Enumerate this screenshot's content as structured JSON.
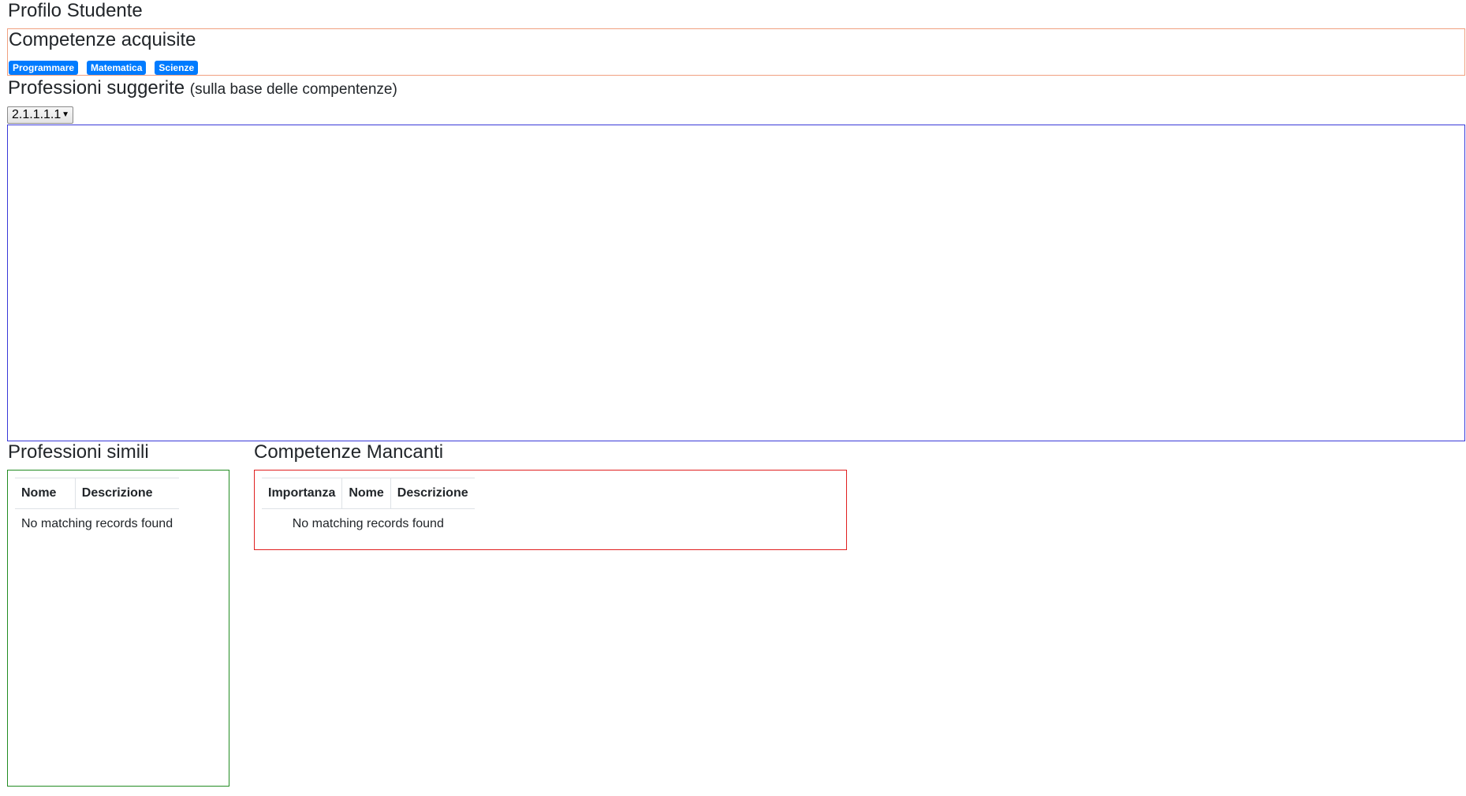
{
  "page": {
    "title": "Profilo Studente"
  },
  "acquired_skills": {
    "title": "Competenze acquisite",
    "badges": [
      "Programmare",
      "Matematica",
      "Scienze"
    ],
    "badge_color": "#007bff",
    "border_color": "#f0a080"
  },
  "suggested_professions": {
    "title": "Professioni suggerite",
    "subtitle": "(sulla base delle compentenze)",
    "select_value": "2.1.1.1.1",
    "border_color": "#3838d8"
  },
  "similar_professions": {
    "title": "Professioni simili",
    "columns": [
      "Nome",
      "Descrizione"
    ],
    "empty_message": "No matching records found",
    "border_color": "#228b22"
  },
  "missing_skills": {
    "title": "Competenze Mancanti",
    "columns": [
      "Importanza",
      "Nome",
      "Descrizione"
    ],
    "empty_message": "No matching records found",
    "border_color": "#e02020"
  }
}
